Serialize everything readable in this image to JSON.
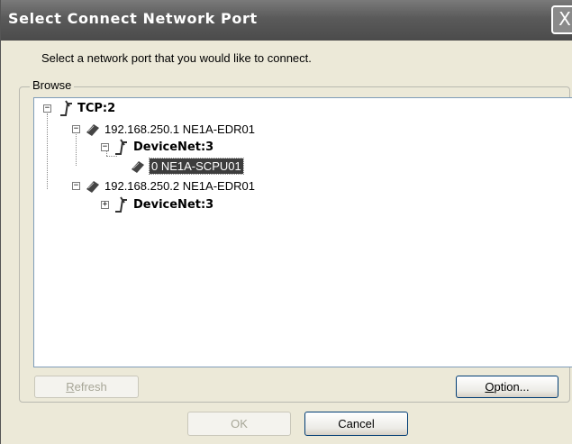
{
  "window": {
    "title": "Select Connect Network Port",
    "close_glyph": "X"
  },
  "instruction": "Select a network port that you would like to connect.",
  "browse": {
    "label": "Browse",
    "tree": [
      {
        "label": "TCP:2",
        "bold": true,
        "expander": "−",
        "icon": "network-port-icon"
      },
      {
        "label": "192.168.250.1 NE1A-EDR01",
        "bold": false,
        "expander": "−",
        "icon": "device-icon"
      },
      {
        "label": "DeviceNet:3",
        "bold": true,
        "expander": "−",
        "icon": "network-port-icon"
      },
      {
        "label": "0 NE1A-SCPU01",
        "bold": false,
        "expander": "",
        "icon": "device-icon",
        "selected": true
      },
      {
        "label": "192.168.250.2 NE1A-EDR01",
        "bold": false,
        "expander": "−",
        "icon": "device-icon"
      },
      {
        "label": "DeviceNet:3",
        "bold": true,
        "expander": "+",
        "icon": "network-port-icon"
      }
    ]
  },
  "buttons": {
    "refresh_first": "R",
    "refresh_rest": "efresh",
    "option_first": "O",
    "option_rest": "ption...",
    "ok": "OK",
    "cancel": "Cancel"
  }
}
